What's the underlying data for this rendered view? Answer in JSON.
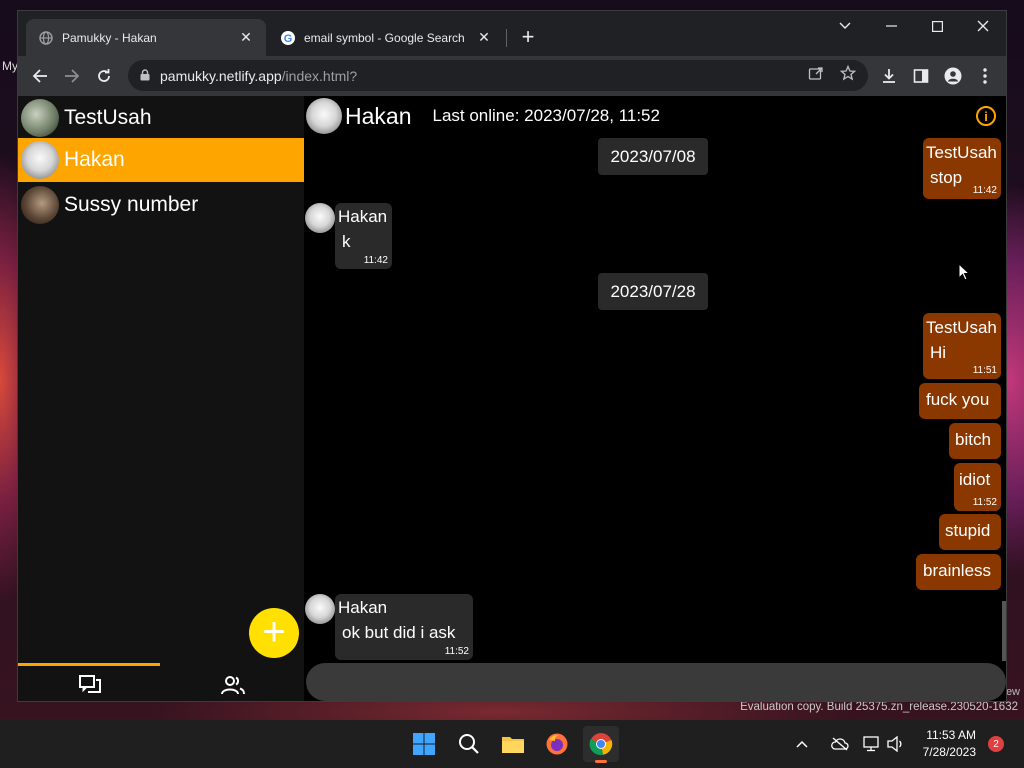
{
  "browser": {
    "tabs": [
      {
        "title": "Pamukky - Hakan",
        "active": true
      },
      {
        "title": "email symbol - Google Search",
        "active": false
      }
    ],
    "url_host": "pamukky.netlify.app",
    "url_path": "/index.html?"
  },
  "sidebar": {
    "contacts": [
      {
        "name": "TestUsah",
        "selected": false
      },
      {
        "name": "Hakan",
        "selected": true
      },
      {
        "name": "Sussy number",
        "selected": false
      }
    ],
    "fab_label": "+"
  },
  "chat": {
    "header": {
      "name": "Hakan",
      "last_online": "Last online: 2023/07/28, 11:52",
      "info_icon": "i"
    },
    "top_out": {
      "sender": "TestUsah",
      "text": "stop",
      "time": "11:42"
    },
    "dates": [
      "2023/07/08",
      "2023/07/28"
    ],
    "in1": {
      "sender": "Hakan",
      "text": "k",
      "time": "11:42"
    },
    "out_hi": {
      "sender": "TestUsah",
      "text": "Hi",
      "time": "11:51"
    },
    "out_msgs": [
      {
        "text": "fuck you"
      },
      {
        "text": "bitch"
      },
      {
        "text": "idiot",
        "time": "11:52"
      },
      {
        "text": "stupid"
      },
      {
        "text": "brainless"
      }
    ],
    "in2": {
      "sender": "Hakan",
      "text": "ok but did i ask",
      "time": "11:52"
    }
  },
  "desktop": {
    "watermark": "Evaluation copy. Build 25375.zn_release.230520-1632",
    "fragment_left": "My",
    "fragment_right": "ew"
  },
  "taskbar": {
    "time": "11:53 AM",
    "date": "7/28/2023",
    "notifications": "2"
  }
}
